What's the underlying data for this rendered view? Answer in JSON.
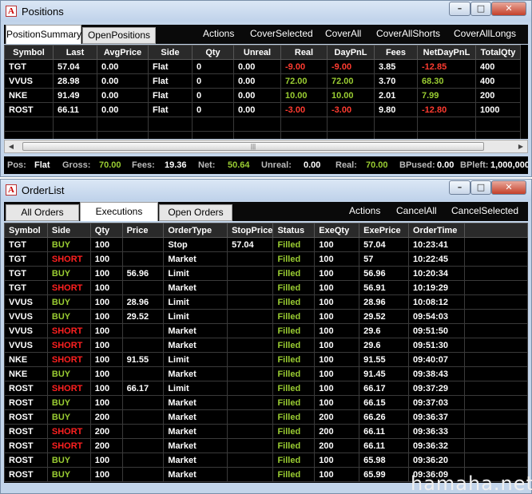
{
  "colors": {
    "positive": "#9acd32",
    "negative": "#ff3b30",
    "buy": "#9acd32",
    "short": "#ff2020",
    "status": "#9acd32",
    "background": "#000000"
  },
  "positions_window": {
    "title": "Positions",
    "tabs": [
      "PositionSummary",
      "OpenPositions"
    ],
    "actions": [
      "Actions",
      "CoverSelected",
      "CoverAll",
      "CoverAllShorts",
      "CoverAllLongs"
    ],
    "columns": [
      "Symbol",
      "Last",
      "AvgPrice",
      "Side",
      "Qty",
      "Unreal",
      "Real",
      "DayPnL",
      "Fees",
      "NetDayPnL",
      "TotalQty"
    ],
    "rows": [
      [
        "TGT",
        "57.04",
        "0.00",
        "Flat",
        "0",
        "0.00",
        "-9.00",
        "-9.00",
        "3.85",
        "-12.85",
        "400"
      ],
      [
        "VVUS",
        "28.98",
        "0.00",
        "Flat",
        "0",
        "0.00",
        "72.00",
        "72.00",
        "3.70",
        "68.30",
        "400"
      ],
      [
        "NKE",
        "91.49",
        "0.00",
        "Flat",
        "0",
        "0.00",
        "10.00",
        "10.00",
        "2.01",
        "7.99",
        "200"
      ],
      [
        "ROST",
        "66.11",
        "0.00",
        "Flat",
        "0",
        "0.00",
        "-3.00",
        "-3.00",
        "9.80",
        "-12.80",
        "1000"
      ]
    ],
    "summary": {
      "pos_label": "Pos:",
      "pos": "Flat",
      "gross_label": "Gross:",
      "gross": "70.00",
      "fees_label": "Fees:",
      "fees": "19.36",
      "net_label": "Net:",
      "net": "50.64",
      "unreal_label": "Unreal:",
      "unreal": "0.00",
      "real_label": "Real:",
      "real": "70.00",
      "bpused_label": "BPused:",
      "bpused": "0.00",
      "bpleft_label": "BPleft:",
      "bpleft": "1,000,000"
    }
  },
  "orderlist_window": {
    "title": "OrderList",
    "tabs": [
      "All Orders",
      "Executions",
      "Open Orders"
    ],
    "actions": [
      "Actions",
      "CancelAll",
      "CancelSelected"
    ],
    "columns": [
      "Symbol",
      "Side",
      "Qty",
      "Price",
      "OrderType",
      "StopPrice",
      "Status",
      "ExeQty",
      "ExePrice",
      "OrderTime"
    ],
    "rows": [
      [
        "TGT",
        "BUY",
        "100",
        "",
        "Stop",
        "57.04",
        "Filled",
        "100",
        "57.04",
        "10:23:41"
      ],
      [
        "TGT",
        "SHORT",
        "100",
        "",
        "Market",
        "",
        "Filled",
        "100",
        "57",
        "10:22:45"
      ],
      [
        "TGT",
        "BUY",
        "100",
        "56.96",
        "Limit",
        "",
        "Filled",
        "100",
        "56.96",
        "10:20:34"
      ],
      [
        "TGT",
        "SHORT",
        "100",
        "",
        "Market",
        "",
        "Filled",
        "100",
        "56.91",
        "10:19:29"
      ],
      [
        "VVUS",
        "BUY",
        "100",
        "28.96",
        "Limit",
        "",
        "Filled",
        "100",
        "28.96",
        "10:08:12"
      ],
      [
        "VVUS",
        "BUY",
        "100",
        "29.52",
        "Limit",
        "",
        "Filled",
        "100",
        "29.52",
        "09:54:03"
      ],
      [
        "VVUS",
        "SHORT",
        "100",
        "",
        "Market",
        "",
        "Filled",
        "100",
        "29.6",
        "09:51:50"
      ],
      [
        "VVUS",
        "SHORT",
        "100",
        "",
        "Market",
        "",
        "Filled",
        "100",
        "29.6",
        "09:51:30"
      ],
      [
        "NKE",
        "SHORT",
        "100",
        "91.55",
        "Limit",
        "",
        "Filled",
        "100",
        "91.55",
        "09:40:07"
      ],
      [
        "NKE",
        "BUY",
        "100",
        "",
        "Market",
        "",
        "Filled",
        "100",
        "91.45",
        "09:38:43"
      ],
      [
        "ROST",
        "SHORT",
        "100",
        "66.17",
        "Limit",
        "",
        "Filled",
        "100",
        "66.17",
        "09:37:29"
      ],
      [
        "ROST",
        "BUY",
        "100",
        "",
        "Market",
        "",
        "Filled",
        "100",
        "66.15",
        "09:37:03"
      ],
      [
        "ROST",
        "BUY",
        "200",
        "",
        "Market",
        "",
        "Filled",
        "200",
        "66.26",
        "09:36:37"
      ],
      [
        "ROST",
        "SHORT",
        "200",
        "",
        "Market",
        "",
        "Filled",
        "200",
        "66.11",
        "09:36:33"
      ],
      [
        "ROST",
        "SHORT",
        "200",
        "",
        "Market",
        "",
        "Filled",
        "200",
        "66.11",
        "09:36:32"
      ],
      [
        "ROST",
        "BUY",
        "100",
        "",
        "Market",
        "",
        "Filled",
        "100",
        "65.98",
        "09:36:20"
      ],
      [
        "ROST",
        "BUY",
        "100",
        "",
        "Market",
        "",
        "Filled",
        "100",
        "65.99",
        "09:36:09"
      ]
    ]
  },
  "watermark": "hamaha.net"
}
